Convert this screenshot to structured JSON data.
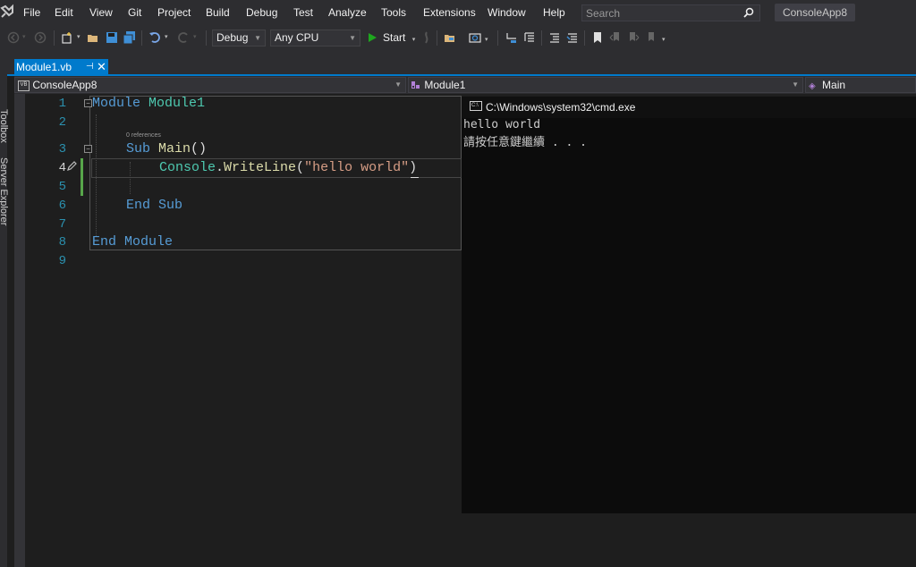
{
  "menu": [
    "File",
    "Edit",
    "View",
    "Git",
    "Project",
    "Build",
    "Debug",
    "Test",
    "Analyze",
    "Tools",
    "Extensions",
    "Window",
    "Help"
  ],
  "search": {
    "placeholder": "Search"
  },
  "solution_name": "ConsoleApp8",
  "toolbar": {
    "configuration": "Debug",
    "platform": "Any CPU",
    "start_label": "Start"
  },
  "side_panels": [
    "Toolbox",
    "Server Explorer"
  ],
  "tab": {
    "title": "Module1.vb"
  },
  "navbar": {
    "project": "ConsoleApp8",
    "project_badge": "VB",
    "type": "Module1",
    "member": "Main"
  },
  "editor": {
    "line_numbers": [
      "1",
      "2",
      "3",
      "4",
      "5",
      "6",
      "7",
      "8",
      "9"
    ],
    "codelens": "0 references",
    "lines": [
      {
        "kw1": "Module",
        "name": "Module1"
      },
      {
        "kw1": "Sub",
        "name": "Main",
        "rest": "()"
      },
      {
        "obj": "Console",
        "dot": ".",
        "method": "WriteLine",
        "open": "(",
        "str": "\"hello world\"",
        "close": ")"
      },
      {
        "kw1": "End",
        "kw2": "Sub"
      },
      {
        "kw1": "End",
        "kw2": "Module"
      }
    ]
  },
  "console": {
    "title": "C:\\Windows\\system32\\cmd.exe",
    "icon_text": "C:\\",
    "lines": [
      "hello world",
      "請按任意鍵繼續 . . ."
    ]
  },
  "colors": {
    "accent": "#007acc",
    "keyword": "#569cd6",
    "type": "#4ec9b0",
    "string": "#d69d85",
    "method": "#dcdcaa"
  }
}
